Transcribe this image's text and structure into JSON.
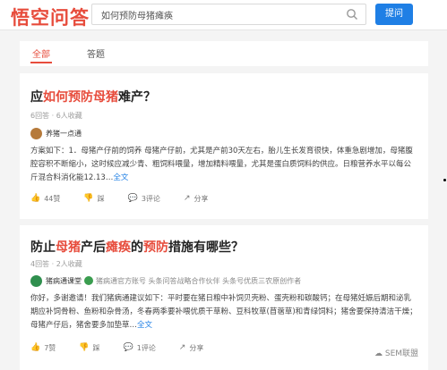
{
  "header": {
    "logo": "悟空问答",
    "search_value": "如何预防母猪瘫痪",
    "ask_label": "提问"
  },
  "tabs": [
    "全部",
    "答题"
  ],
  "q1": {
    "title_pre": "应",
    "title_hl": "如何预防母猪",
    "title_post": "难产？",
    "meta": "6回答 · 6人收藏",
    "author": "养猪一点通",
    "body": "方案如下：1．母猪产仔前的饲养 母猪产仔前，尤其是产前30天左右，胎儿生长发育很快，体重急剧增加，母猪腹腔容积不断缩小，这时候应减少青、粗饲料喂量，增加精料喂量，尤其是蛋白质饲料的供应。日粮营养水平以每公斤混合料消化能12.13…",
    "more": "全文",
    "likes": "44赞",
    "dislike": "踩",
    "comments": "3评论",
    "share": "分享"
  },
  "q2": {
    "title_a": "防止",
    "title_b": "母猪",
    "title_c": "产后",
    "title_d": "瘫痪",
    "title_e": "的",
    "title_f": "预防",
    "title_g": "措施有哪些？",
    "meta": "4回答 · 2人收藏",
    "author": "猪病通课堂",
    "author_tag": "猪病通官方账号 头条问答战略合作伙伴 头条号优质三农原创作者",
    "body": "你好，多谢邀请！我们猪病通建议如下：平时要在猪日粮中补饲贝壳粉、蛋壳粉和碳酸钙；在母猪妊娠后期和泌乳期应补饲骨粉、鱼粉和杂骨汤，冬春两季要补喂优质干草粉、豆科牧草(苜蓿草)和青绿饲料；猪舍要保持清洁干燥；母猪产仔后，猪舍要多加垫草…",
    "more": "全文",
    "likes": "7赞",
    "dislike": "踩",
    "comments": "1评论",
    "share": "分享"
  },
  "watermark": "SEM联盟",
  "colors": {
    "accent": "#e74c3c",
    "button": "#1f7fe5",
    "link": "#1f7fe5"
  }
}
